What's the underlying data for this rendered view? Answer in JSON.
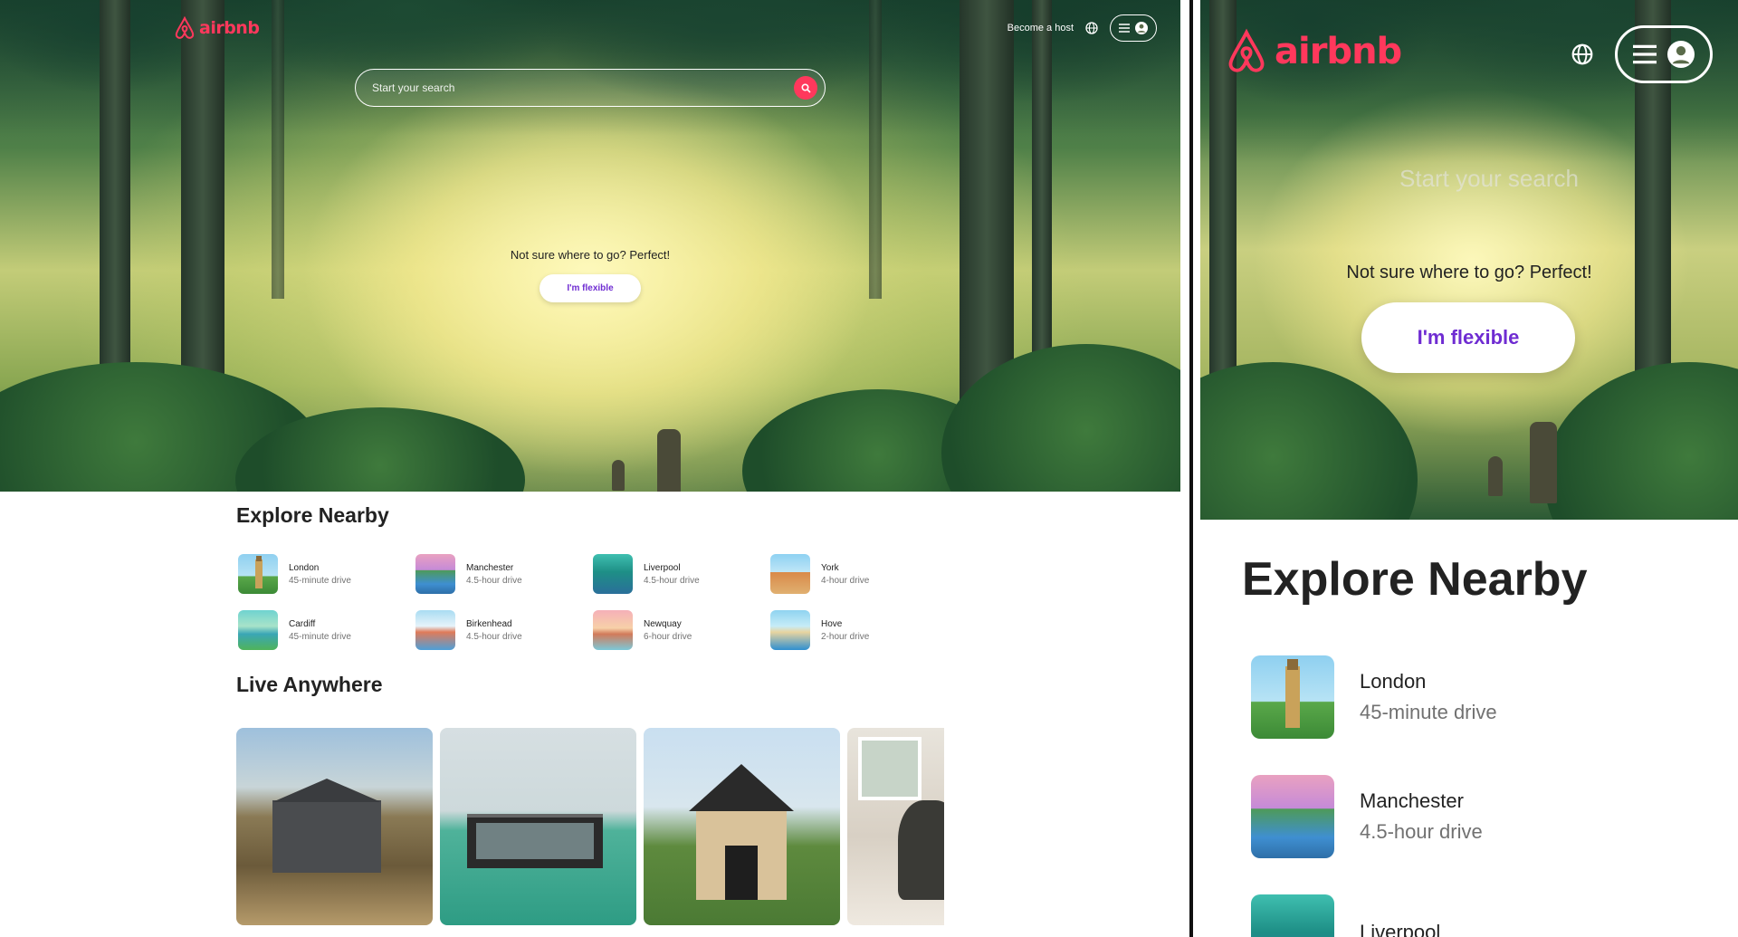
{
  "brand": {
    "name": "airbnb",
    "color": "#ff385c"
  },
  "header": {
    "host_link": "Become a host",
    "icons": [
      "globe-icon",
      "menu-icon",
      "user-avatar-icon"
    ]
  },
  "search": {
    "placeholder": "Start your search"
  },
  "hero": {
    "tagline": "Not sure where to go? Perfect!",
    "flexible_button": "I'm flexible",
    "accent": "#6f2cd2"
  },
  "explore_nearby": {
    "title": "Explore Nearby",
    "items": [
      {
        "name": "London",
        "distance": "45-minute drive"
      },
      {
        "name": "Manchester",
        "distance": "4.5-hour drive"
      },
      {
        "name": "Liverpool",
        "distance": "4.5-hour drive"
      },
      {
        "name": "York",
        "distance": "4-hour drive"
      },
      {
        "name": "Cardiff",
        "distance": "45-minute drive"
      },
      {
        "name": "Birkenhead",
        "distance": "4.5-hour drive"
      },
      {
        "name": "Newquay",
        "distance": "6-hour drive"
      },
      {
        "name": "Hove",
        "distance": "2-hour drive"
      }
    ]
  },
  "live_anywhere": {
    "title": "Live Anywhere",
    "cards": [
      "countryside-house",
      "floating-house",
      "forest-cabin",
      "cozy-bedroom"
    ]
  },
  "zoom": {
    "search_ghost": "Start your search",
    "tagline": "Not sure where to go? Perfect!",
    "flexible_button": "I'm flexible",
    "title": "Explore Nearby",
    "items": [
      {
        "name": "London",
        "distance": "45-minute drive"
      },
      {
        "name": "Manchester",
        "distance": "4.5-hour drive"
      },
      {
        "name": "Liverpool",
        "distance": ""
      }
    ]
  }
}
